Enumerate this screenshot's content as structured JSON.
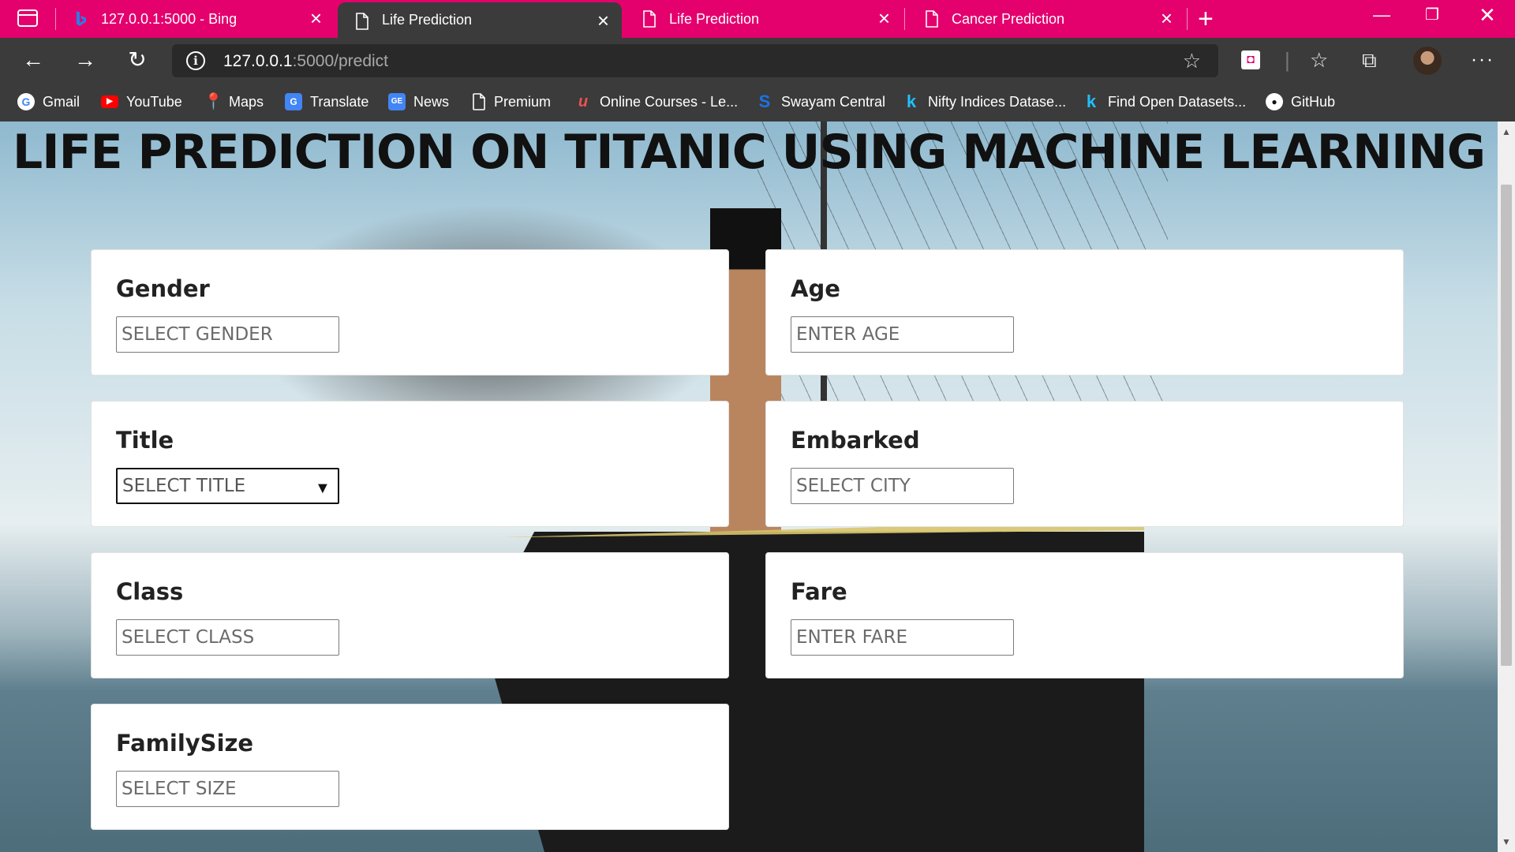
{
  "browser": {
    "tabs": [
      {
        "title": "127.0.0.1:5000 - Bing",
        "active": false,
        "favicon": "bing-icon"
      },
      {
        "title": "Life Prediction",
        "active": true,
        "favicon": "page-icon"
      },
      {
        "title": "Life Prediction",
        "active": false,
        "favicon": "page-icon"
      },
      {
        "title": "Cancer Prediction",
        "active": false,
        "favicon": "page-icon"
      }
    ],
    "url_host": "127.0.0.1",
    "url_path": ":5000/predict",
    "bookmarks": [
      {
        "label": "Gmail",
        "icon": "google-icon",
        "color": "#4285f4"
      },
      {
        "label": "YouTube",
        "icon": "youtube-icon",
        "color": "#ff0000"
      },
      {
        "label": "Maps",
        "icon": "maps-icon",
        "color": "#34a853"
      },
      {
        "label": "Translate",
        "icon": "translate-icon",
        "color": "#4285f4"
      },
      {
        "label": "News",
        "icon": "news-icon",
        "color": "#4285f4"
      },
      {
        "label": "Premium",
        "icon": "page-icon",
        "color": "#3b3b3b"
      },
      {
        "label": "Online Courses - Le...",
        "icon": "udemy-icon",
        "color": "#ec5252"
      },
      {
        "label": "Swayam Central",
        "icon": "swayam-icon",
        "color": "#1a73e8"
      },
      {
        "label": "Nifty Indices Datase...",
        "icon": "kaggle-icon",
        "color": "#20beff"
      },
      {
        "label": "Find Open Datasets...",
        "icon": "kaggle-icon",
        "color": "#20beff"
      },
      {
        "label": "GitHub",
        "icon": "github-icon",
        "color": "#ffffff"
      }
    ],
    "accent": "#e4006d"
  },
  "page": {
    "title": "LIFE PREDICTION ON TITANIC USING MACHINE LEARNING",
    "fields": {
      "gender": {
        "label": "Gender",
        "placeholder": "SELECT GENDER"
      },
      "age": {
        "label": "Age",
        "placeholder": "ENTER AGE"
      },
      "title": {
        "label": "Title",
        "selected": "SELECT TITLE"
      },
      "embarked": {
        "label": "Embarked",
        "placeholder": "SELECT CITY"
      },
      "class": {
        "label": "Class",
        "placeholder": "SELECT CLASS"
      },
      "fare": {
        "label": "Fare",
        "placeholder": "ENTER FARE"
      },
      "familysize": {
        "label": "FamilySize",
        "placeholder": "SELECT SIZE"
      }
    }
  }
}
